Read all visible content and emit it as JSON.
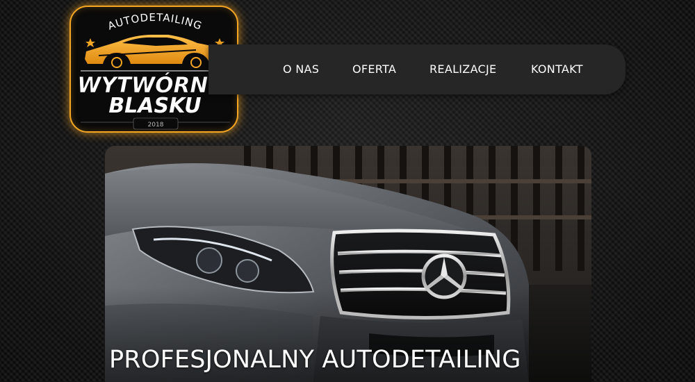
{
  "logo": {
    "top_text": "AUTODETAILING",
    "line1": "WYTWÓRNIA",
    "line2": "BLASKU",
    "year": "2018"
  },
  "nav": {
    "items": [
      {
        "label": "O NAS"
      },
      {
        "label": "OFERTA"
      },
      {
        "label": "REALIZACJE"
      },
      {
        "label": "KONTAKT"
      }
    ]
  },
  "hero": {
    "headline": "PROFESJONALNY AUTODETAILING",
    "image": "mercedes-car-front-photo"
  },
  "colors": {
    "accent": "#f5a623",
    "navbar": "#262626",
    "background": "#0e0e0e",
    "text": "#ffffff"
  }
}
